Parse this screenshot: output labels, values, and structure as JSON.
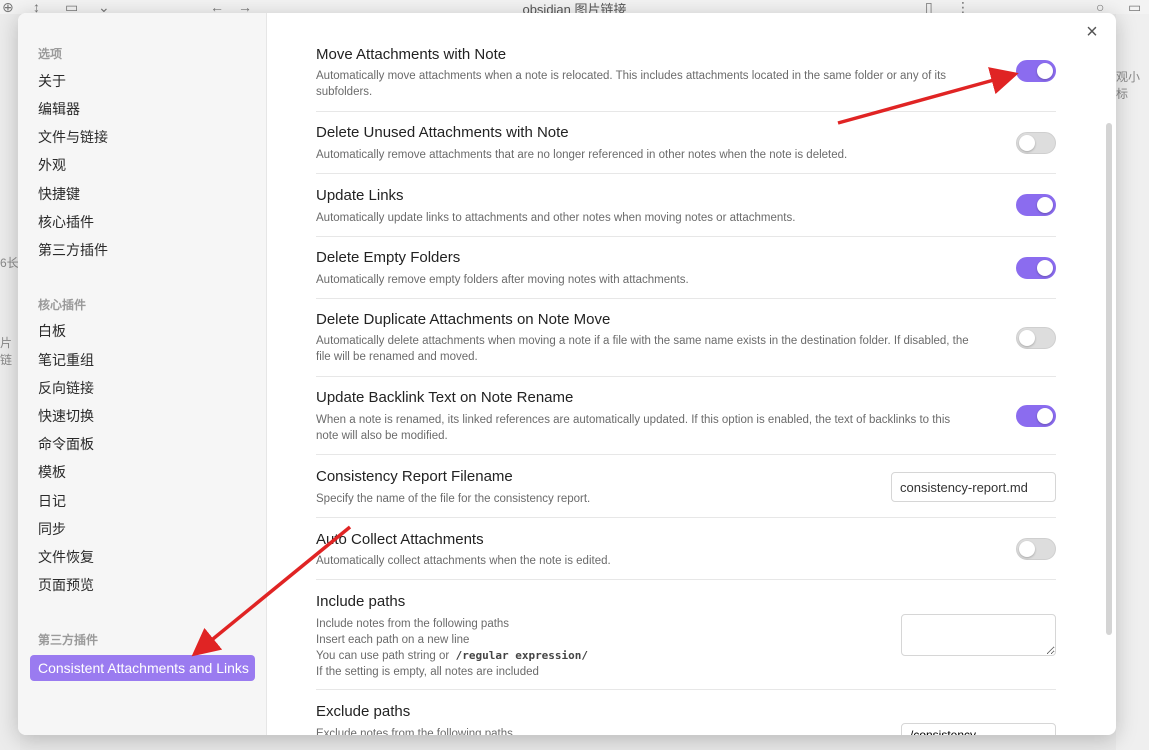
{
  "window": {
    "title": "obsidian 图片链接",
    "side_text_1": "6长",
    "side_text_2": "片链",
    "right_text": "观小标"
  },
  "sidebar": {
    "sections": [
      {
        "heading": "选项",
        "items": [
          "关于",
          "编辑器",
          "文件与链接",
          "外观",
          "快捷键",
          "核心插件",
          "第三方插件"
        ]
      },
      {
        "heading": "核心插件",
        "items": [
          "白板",
          "笔记重组",
          "反向链接",
          "快速切换",
          "命令面板",
          "模板",
          "日记",
          "同步",
          "文件恢复",
          "页面预览"
        ]
      },
      {
        "heading": "第三方插件",
        "items": [
          "Consistent Attachments and Links"
        ]
      }
    ]
  },
  "settings": [
    {
      "name": "Move Attachments with Note",
      "desc": [
        "Automatically move attachments when a note is relocated. This includes attachments located in the same folder or any of its",
        "subfolders."
      ],
      "control": "toggle",
      "value": true
    },
    {
      "name": "Delete Unused Attachments with Note",
      "desc": [
        "Automatically remove attachments that are no longer referenced in other notes when the note is deleted."
      ],
      "control": "toggle",
      "value": false
    },
    {
      "name": "Update Links",
      "desc": [
        "Automatically update links to attachments and other notes when moving notes or attachments."
      ],
      "control": "toggle",
      "value": true
    },
    {
      "name": "Delete Empty Folders",
      "desc": [
        "Automatically remove empty folders after moving notes with attachments."
      ],
      "control": "toggle",
      "value": true
    },
    {
      "name": "Delete Duplicate Attachments on Note Move",
      "desc": [
        "Automatically delete attachments when moving a note if a file with the same name exists in the destination folder. If disabled, the",
        "file will be renamed and moved."
      ],
      "control": "toggle",
      "value": false
    },
    {
      "name": "Update Backlink Text on Note Rename",
      "desc": [
        "When a note is renamed, its linked references are automatically updated. If this option is enabled, the text of backlinks to this",
        "note will also be modified."
      ],
      "control": "toggle",
      "value": true
    },
    {
      "name": "Consistency Report Filename",
      "desc": [
        "Specify the name of the file for the consistency report."
      ],
      "control": "text",
      "value": "consistency-report.md"
    },
    {
      "name": "Auto Collect Attachments",
      "desc": [
        "Automatically collect attachments when the note is edited."
      ],
      "control": "toggle",
      "value": false
    },
    {
      "name": "Include paths",
      "desc": [
        "Include notes from the following paths",
        "Insert each path on a new line",
        "You can use path string or",
        "If the setting is empty, all notes are included"
      ],
      "regex_hint": "/regular expression/",
      "control": "textarea",
      "value": ""
    },
    {
      "name": "Exclude paths",
      "desc": [
        "Exclude notes from the following paths"
      ],
      "control": "textarea",
      "value": "/consistency"
    }
  ],
  "colors": {
    "accent": "#8b6cef",
    "active_sidebar": "#9a7bf0",
    "annotation_arrow": "#e02424"
  }
}
